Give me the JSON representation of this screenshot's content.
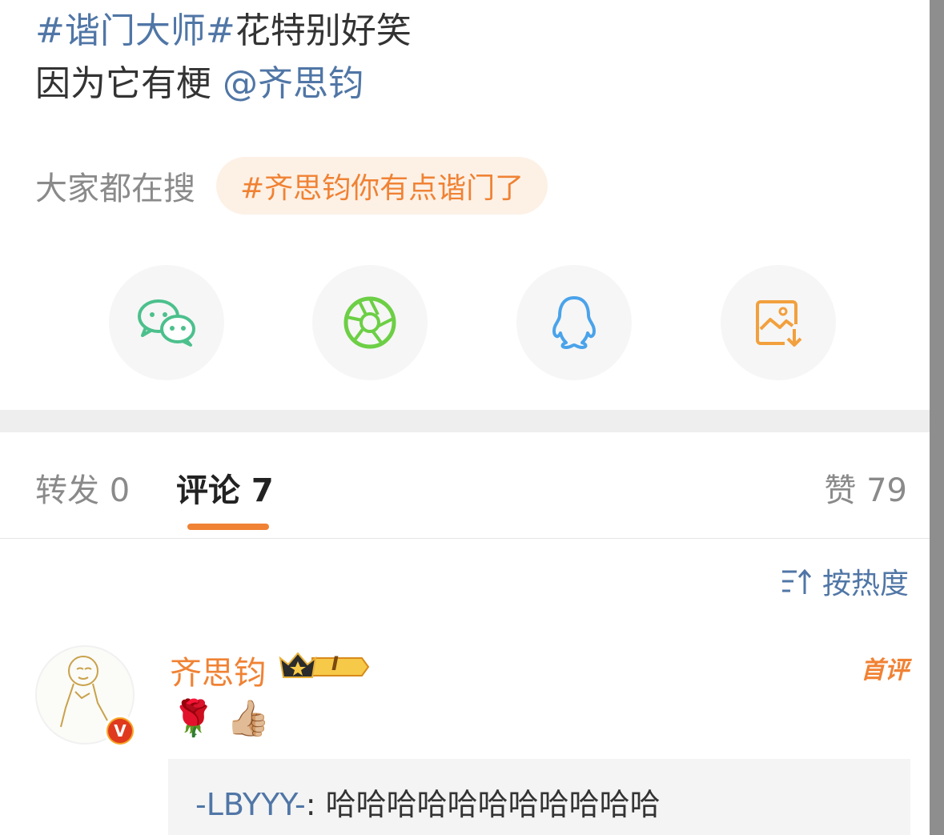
{
  "post": {
    "topic_text": "#谐门大师#",
    "line1_rest": "花特别好笑",
    "line2_text": "因为它有梗",
    "mention_text": "@齐思钧"
  },
  "hot_search": {
    "label": "大家都在搜",
    "chip_text": "#齐思钧你有点谐门了"
  },
  "share_buttons": [
    {
      "icon": "wechat-icon",
      "color": "#4cc08c"
    },
    {
      "icon": "moments-icon",
      "color": "#6ccf45"
    },
    {
      "icon": "qq-icon",
      "color": "#4aa3ea"
    },
    {
      "icon": "save-image-icon",
      "color": "#f2a03d"
    }
  ],
  "tabs": {
    "repost_label": "转发 0",
    "comment_label": "评论 7",
    "like_label": "赞 79"
  },
  "sort": {
    "label": "按热度"
  },
  "comment": {
    "username": "齐思钧",
    "level_text": "I",
    "first_label": "首评",
    "content_emojis": "🌹 👍🏼",
    "verified_mark": "V",
    "reply_user": "-LBYYY-",
    "reply_sep": ": ",
    "reply_text": "哈哈哈哈哈哈哈哈哈哈哈"
  },
  "colors": {
    "accent": "#f08234",
    "link": "#5076a6"
  }
}
